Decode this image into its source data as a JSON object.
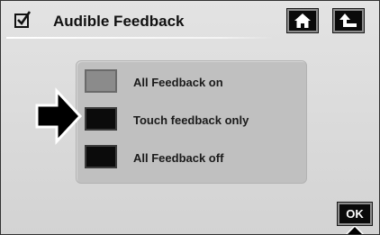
{
  "header": {
    "title": "Audible Feedback",
    "left_icon": "checkbox-icon",
    "home_icon": "home-icon",
    "back_icon": "return-arrow-icon"
  },
  "options": [
    {
      "label": "All Feedback on",
      "selected": true
    },
    {
      "label": "Touch feedback only",
      "selected": false
    },
    {
      "label": "All Feedback off",
      "selected": false
    }
  ],
  "indicator_icon": "pointer-arrow-icon",
  "footer": {
    "ok_label": "OK"
  },
  "colors": {
    "background": "#dadada",
    "panel": "#c0c0c0",
    "button": "#0a0a0a",
    "selected_option": "#8b8b8b"
  }
}
